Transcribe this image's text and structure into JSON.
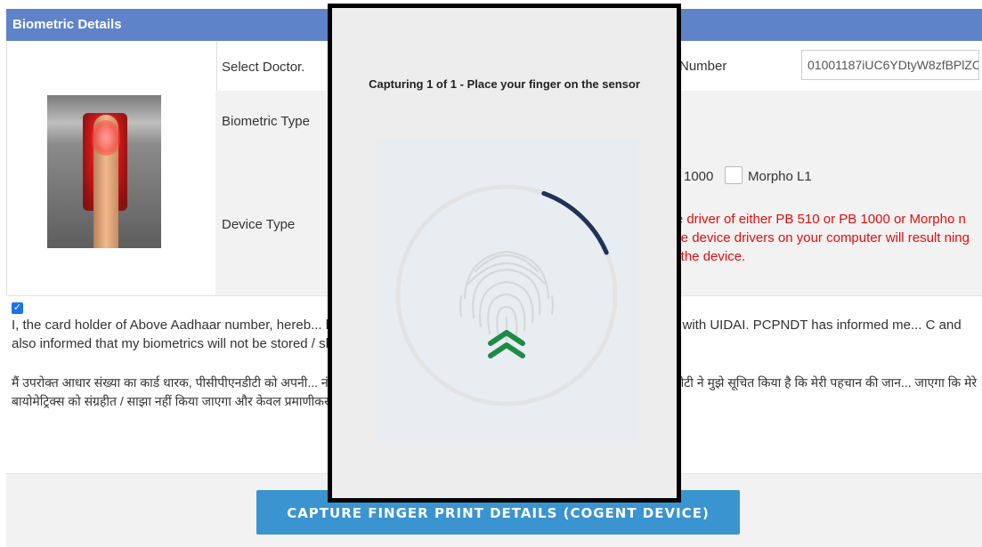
{
  "header": {
    "title": "Biometric Details"
  },
  "form": {
    "select_doctor_label": "Select Doctor.",
    "biometric_type_label": "Biometric Type",
    "device_type_label": "Device Type",
    "number_label": "Number",
    "number_value": "01001187iUC6YDtyW8zfBPlZC",
    "device_option_1000": "1000",
    "device_option_morpho": "Morpho L1",
    "device_warning": "ice driver of either PB 510 or PB 1000 or Morpho n one device drivers on your computer will result ning of the device."
  },
  "consent": {
    "checked": true,
    "text_en": "I, the card holder of Above Aadhaar number, hereb... ber, name and Fingerprint/Iris and/or OTP for authentication with UIDAI. PCPNDT has informed me... C and also informed that my biometrics will not be stored / shared and will be submitted to CIDR or...",
    "text_hi": "मैं उपरोक्त आधार संख्या का कार्ड धारक, पीसीपीएनडीटी को अपनी... नंबर, नाम और फिंगरप्रिंट / आइरिस और / या ओटीपी प्राप्त कर सके। पीसीपीएनडीटी ने मुझे सूचित किया है कि मेरी पहचान की जान... जाएगा कि मेरे बायोमेट्रिक्स को संग्रहीत / साझा नहीं किया जाएगा और केवल प्रमाणीकरण के उद्देश्य से सीआईडीआर को प्रस्तु..."
  },
  "footer": {
    "capture_button": "CAPTURE FINGER PRINT DETAILS (COGENT DEVICE)"
  },
  "modal": {
    "title": "Capturing 1 of 1 - Place your finger on the sensor",
    "progress_fraction": 0.13,
    "colors": {
      "progress": "#1e3358",
      "chevron": "#1e8a46",
      "ring": "#e3e3e3"
    }
  }
}
